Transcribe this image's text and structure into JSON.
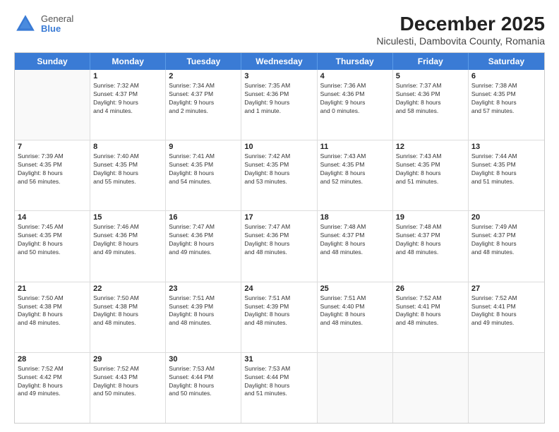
{
  "header": {
    "logo": {
      "line1": "General",
      "line2": "Blue"
    },
    "title": "December 2025",
    "subtitle": "Niculesti, Dambovita County, Romania"
  },
  "days_of_week": [
    "Sunday",
    "Monday",
    "Tuesday",
    "Wednesday",
    "Thursday",
    "Friday",
    "Saturday"
  ],
  "weeks": [
    [
      {
        "day": "",
        "info": ""
      },
      {
        "day": "1",
        "info": "Sunrise: 7:32 AM\nSunset: 4:37 PM\nDaylight: 9 hours\nand 4 minutes."
      },
      {
        "day": "2",
        "info": "Sunrise: 7:34 AM\nSunset: 4:37 PM\nDaylight: 9 hours\nand 2 minutes."
      },
      {
        "day": "3",
        "info": "Sunrise: 7:35 AM\nSunset: 4:36 PM\nDaylight: 9 hours\nand 1 minute."
      },
      {
        "day": "4",
        "info": "Sunrise: 7:36 AM\nSunset: 4:36 PM\nDaylight: 9 hours\nand 0 minutes."
      },
      {
        "day": "5",
        "info": "Sunrise: 7:37 AM\nSunset: 4:36 PM\nDaylight: 8 hours\nand 58 minutes."
      },
      {
        "day": "6",
        "info": "Sunrise: 7:38 AM\nSunset: 4:35 PM\nDaylight: 8 hours\nand 57 minutes."
      }
    ],
    [
      {
        "day": "7",
        "info": "Sunrise: 7:39 AM\nSunset: 4:35 PM\nDaylight: 8 hours\nand 56 minutes."
      },
      {
        "day": "8",
        "info": "Sunrise: 7:40 AM\nSunset: 4:35 PM\nDaylight: 8 hours\nand 55 minutes."
      },
      {
        "day": "9",
        "info": "Sunrise: 7:41 AM\nSunset: 4:35 PM\nDaylight: 8 hours\nand 54 minutes."
      },
      {
        "day": "10",
        "info": "Sunrise: 7:42 AM\nSunset: 4:35 PM\nDaylight: 8 hours\nand 53 minutes."
      },
      {
        "day": "11",
        "info": "Sunrise: 7:43 AM\nSunset: 4:35 PM\nDaylight: 8 hours\nand 52 minutes."
      },
      {
        "day": "12",
        "info": "Sunrise: 7:43 AM\nSunset: 4:35 PM\nDaylight: 8 hours\nand 51 minutes."
      },
      {
        "day": "13",
        "info": "Sunrise: 7:44 AM\nSunset: 4:35 PM\nDaylight: 8 hours\nand 51 minutes."
      }
    ],
    [
      {
        "day": "14",
        "info": "Sunrise: 7:45 AM\nSunset: 4:35 PM\nDaylight: 8 hours\nand 50 minutes."
      },
      {
        "day": "15",
        "info": "Sunrise: 7:46 AM\nSunset: 4:36 PM\nDaylight: 8 hours\nand 49 minutes."
      },
      {
        "day": "16",
        "info": "Sunrise: 7:47 AM\nSunset: 4:36 PM\nDaylight: 8 hours\nand 49 minutes."
      },
      {
        "day": "17",
        "info": "Sunrise: 7:47 AM\nSunset: 4:36 PM\nDaylight: 8 hours\nand 48 minutes."
      },
      {
        "day": "18",
        "info": "Sunrise: 7:48 AM\nSunset: 4:37 PM\nDaylight: 8 hours\nand 48 minutes."
      },
      {
        "day": "19",
        "info": "Sunrise: 7:48 AM\nSunset: 4:37 PM\nDaylight: 8 hours\nand 48 minutes."
      },
      {
        "day": "20",
        "info": "Sunrise: 7:49 AM\nSunset: 4:37 PM\nDaylight: 8 hours\nand 48 minutes."
      }
    ],
    [
      {
        "day": "21",
        "info": "Sunrise: 7:50 AM\nSunset: 4:38 PM\nDaylight: 8 hours\nand 48 minutes."
      },
      {
        "day": "22",
        "info": "Sunrise: 7:50 AM\nSunset: 4:38 PM\nDaylight: 8 hours\nand 48 minutes."
      },
      {
        "day": "23",
        "info": "Sunrise: 7:51 AM\nSunset: 4:39 PM\nDaylight: 8 hours\nand 48 minutes."
      },
      {
        "day": "24",
        "info": "Sunrise: 7:51 AM\nSunset: 4:39 PM\nDaylight: 8 hours\nand 48 minutes."
      },
      {
        "day": "25",
        "info": "Sunrise: 7:51 AM\nSunset: 4:40 PM\nDaylight: 8 hours\nand 48 minutes."
      },
      {
        "day": "26",
        "info": "Sunrise: 7:52 AM\nSunset: 4:41 PM\nDaylight: 8 hours\nand 48 minutes."
      },
      {
        "day": "27",
        "info": "Sunrise: 7:52 AM\nSunset: 4:41 PM\nDaylight: 8 hours\nand 49 minutes."
      }
    ],
    [
      {
        "day": "28",
        "info": "Sunrise: 7:52 AM\nSunset: 4:42 PM\nDaylight: 8 hours\nand 49 minutes."
      },
      {
        "day": "29",
        "info": "Sunrise: 7:52 AM\nSunset: 4:43 PM\nDaylight: 8 hours\nand 50 minutes."
      },
      {
        "day": "30",
        "info": "Sunrise: 7:53 AM\nSunset: 4:44 PM\nDaylight: 8 hours\nand 50 minutes."
      },
      {
        "day": "31",
        "info": "Sunrise: 7:53 AM\nSunset: 4:44 PM\nDaylight: 8 hours\nand 51 minutes."
      },
      {
        "day": "",
        "info": ""
      },
      {
        "day": "",
        "info": ""
      },
      {
        "day": "",
        "info": ""
      }
    ]
  ]
}
